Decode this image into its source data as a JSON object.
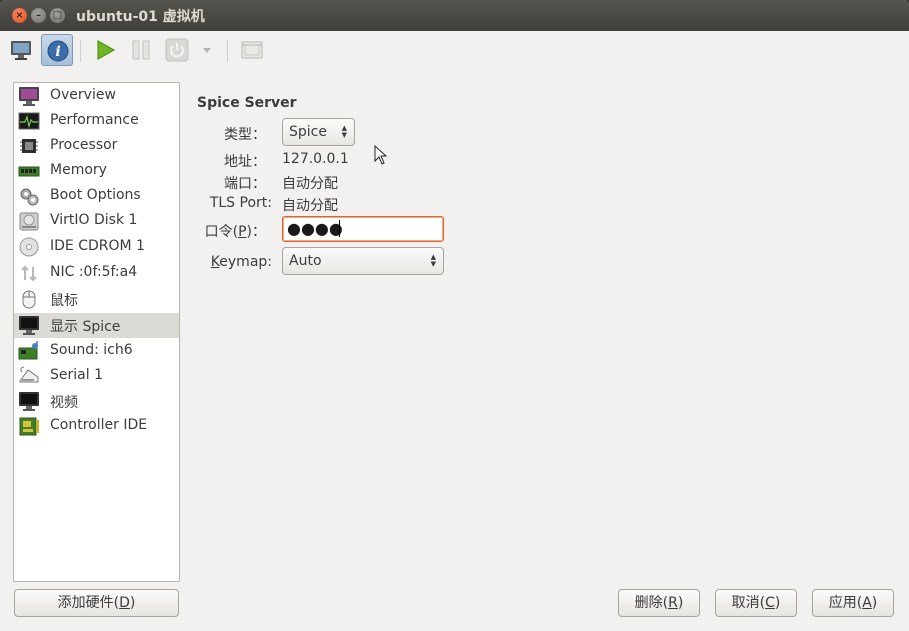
{
  "window": {
    "title": "ubuntu-01 虚拟机"
  },
  "toolbar": {
    "buttons": [
      {
        "icon": "monitor-icon"
      },
      {
        "icon": "info-icon",
        "active": true
      },
      {
        "icon": "play-icon"
      },
      {
        "icon": "pause-icon"
      },
      {
        "icon": "power-icon"
      },
      {
        "icon": "chevron-down-icon"
      },
      {
        "icon": "fullscreen-icon"
      }
    ]
  },
  "sidebar": {
    "items": [
      {
        "label": "Overview",
        "icon": "overview-icon"
      },
      {
        "label": "Performance",
        "icon": "performance-icon"
      },
      {
        "label": "Processor",
        "icon": "processor-icon"
      },
      {
        "label": "Memory",
        "icon": "memory-icon"
      },
      {
        "label": "Boot Options",
        "icon": "boot-options-icon"
      },
      {
        "label": "VirtIO Disk 1",
        "icon": "disk-icon"
      },
      {
        "label": "IDE CDROM 1",
        "icon": "cdrom-icon"
      },
      {
        "label": "NIC :0f:5f:a4",
        "icon": "nic-icon"
      },
      {
        "label": "鼠标",
        "icon": "mouse-icon"
      },
      {
        "label": "显示 Spice",
        "icon": "display-icon",
        "selected": true
      },
      {
        "label": "Sound: ich6",
        "icon": "sound-icon"
      },
      {
        "label": "Serial 1",
        "icon": "serial-icon"
      },
      {
        "label": "视频",
        "icon": "video-icon"
      },
      {
        "label": "Controller IDE",
        "icon": "controller-icon"
      }
    ],
    "add_hardware_label": "添加硬件(",
    "add_hardware_mnemonic": "D",
    "add_hardware_suffix": ")"
  },
  "main": {
    "section_title": "Spice Server",
    "type_label": "类型：",
    "type_value": "Spice",
    "address_label": "地址：",
    "address_value": "127.0.0.1",
    "port_label": "端口：",
    "port_value": "自动分配",
    "tls_port_label": "TLS Port:",
    "tls_port_value": "自动分配",
    "password_label_pre": "口令(",
    "password_mnemonic": "P",
    "password_label_post": ")：",
    "password_value": "●●●●",
    "keymap_mnemonic": "K",
    "keymap_label_rest": "eymap:",
    "keymap_value": "Auto"
  },
  "footer": {
    "delete_pre": "删除(",
    "delete_mnemonic": "R",
    "delete_post": ")",
    "cancel_pre": "取消(",
    "cancel_mnemonic": "C",
    "cancel_post": ")",
    "apply_pre": "应用(",
    "apply_mnemonic": "A",
    "apply_post": ")"
  },
  "colors": {
    "titlebar": "#3f3e3a",
    "close_button": "#df4a16",
    "focus_border": "#e0652c",
    "selected_row": "#dcdad5",
    "play_green": "#4e9a06"
  }
}
